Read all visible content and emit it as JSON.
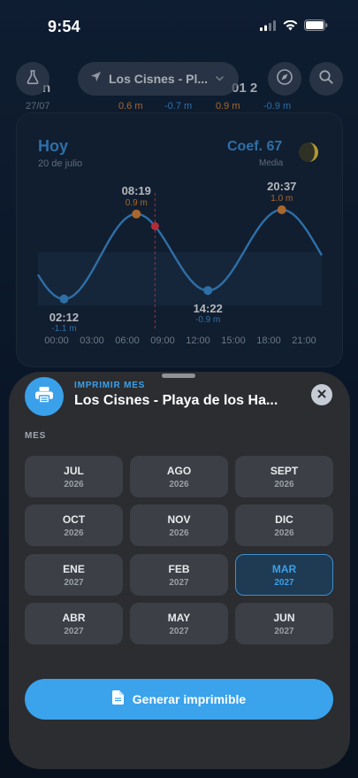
{
  "status_bar": {
    "time": "9:54",
    "icons": [
      "signal-icon",
      "wifi-icon",
      "battery-icon"
    ]
  },
  "top_bar": {
    "location": "Los Cisnes - Pl...",
    "left_icon": "flask-icon",
    "right_icons": [
      "compass-icon",
      "search-icon"
    ]
  },
  "background_peek": {
    "date": "27/07",
    "heights": [
      "0.6 m",
      "-0.7 m",
      "0.9 m",
      "-0.9 m"
    ],
    "partial_text_left": "n",
    "partial_text_right": "01 2"
  },
  "day_card": {
    "title": "Hoy",
    "date": "20 de julio",
    "coef_label": "Coef. 67",
    "coef_sub": "Media",
    "moon_icon": "moon-phase-icon"
  },
  "chart_data": {
    "type": "line",
    "x_ticks": [
      "00:00",
      "03:00",
      "06:00",
      "09:00",
      "12:00",
      "15:00",
      "18:00",
      "21:00"
    ],
    "xlim_hours": [
      0,
      24
    ],
    "ylim_m": [
      -1.3,
      1.3
    ],
    "series": [
      {
        "x_hours": [
          0,
          1,
          2.2,
          3.5,
          5,
          6.5,
          8.3,
          9.5,
          11,
          12.5,
          14.37,
          16,
          17.5,
          19,
          20.62,
          22,
          24
        ],
        "y_m": [
          -0.3,
          -0.8,
          -1.1,
          -0.8,
          0.1,
          0.7,
          0.9,
          0.6,
          -0.1,
          -0.7,
          -0.9,
          -0.5,
          0.2,
          0.8,
          1.0,
          0.6,
          -0.1
        ]
      }
    ],
    "extremes": [
      {
        "time": "02:12",
        "height": "-1.1 m",
        "hour": 2.2,
        "value": -1.1,
        "kind": "low"
      },
      {
        "time": "08:19",
        "height": "0.9 m",
        "hour": 8.32,
        "value": 0.9,
        "kind": "high"
      },
      {
        "time": "14:22",
        "height": "-0.9 m",
        "hour": 14.37,
        "value": -0.9,
        "kind": "low"
      },
      {
        "time": "20:37",
        "height": "1.0 m",
        "hour": 20.62,
        "value": 1.0,
        "kind": "high"
      }
    ],
    "current_hour": 9.9,
    "colors": {
      "line": "#3c8fd6",
      "high": "#d9843a",
      "low": "#3c8fd6",
      "now": "#e0394a"
    }
  },
  "sheet": {
    "kicker": "IMPRIMIR MES",
    "title": "Los Cisnes - Playa de los Ha...",
    "section_label": "MES",
    "months": [
      {
        "name": "JUL",
        "year": "2026"
      },
      {
        "name": "AGO",
        "year": "2026"
      },
      {
        "name": "SEPT",
        "year": "2026"
      },
      {
        "name": "OCT",
        "year": "2026"
      },
      {
        "name": "NOV",
        "year": "2026"
      },
      {
        "name": "DIC",
        "year": "2026"
      },
      {
        "name": "ENE",
        "year": "2027"
      },
      {
        "name": "FEB",
        "year": "2027"
      },
      {
        "name": "MAR",
        "year": "2027"
      },
      {
        "name": "ABR",
        "year": "2027"
      },
      {
        "name": "MAY",
        "year": "2027"
      },
      {
        "name": "JUN",
        "year": "2027"
      }
    ],
    "selected_month": "MAR 2027",
    "generate_label": "Generar imprimible",
    "accent": "#3aa3ec"
  }
}
